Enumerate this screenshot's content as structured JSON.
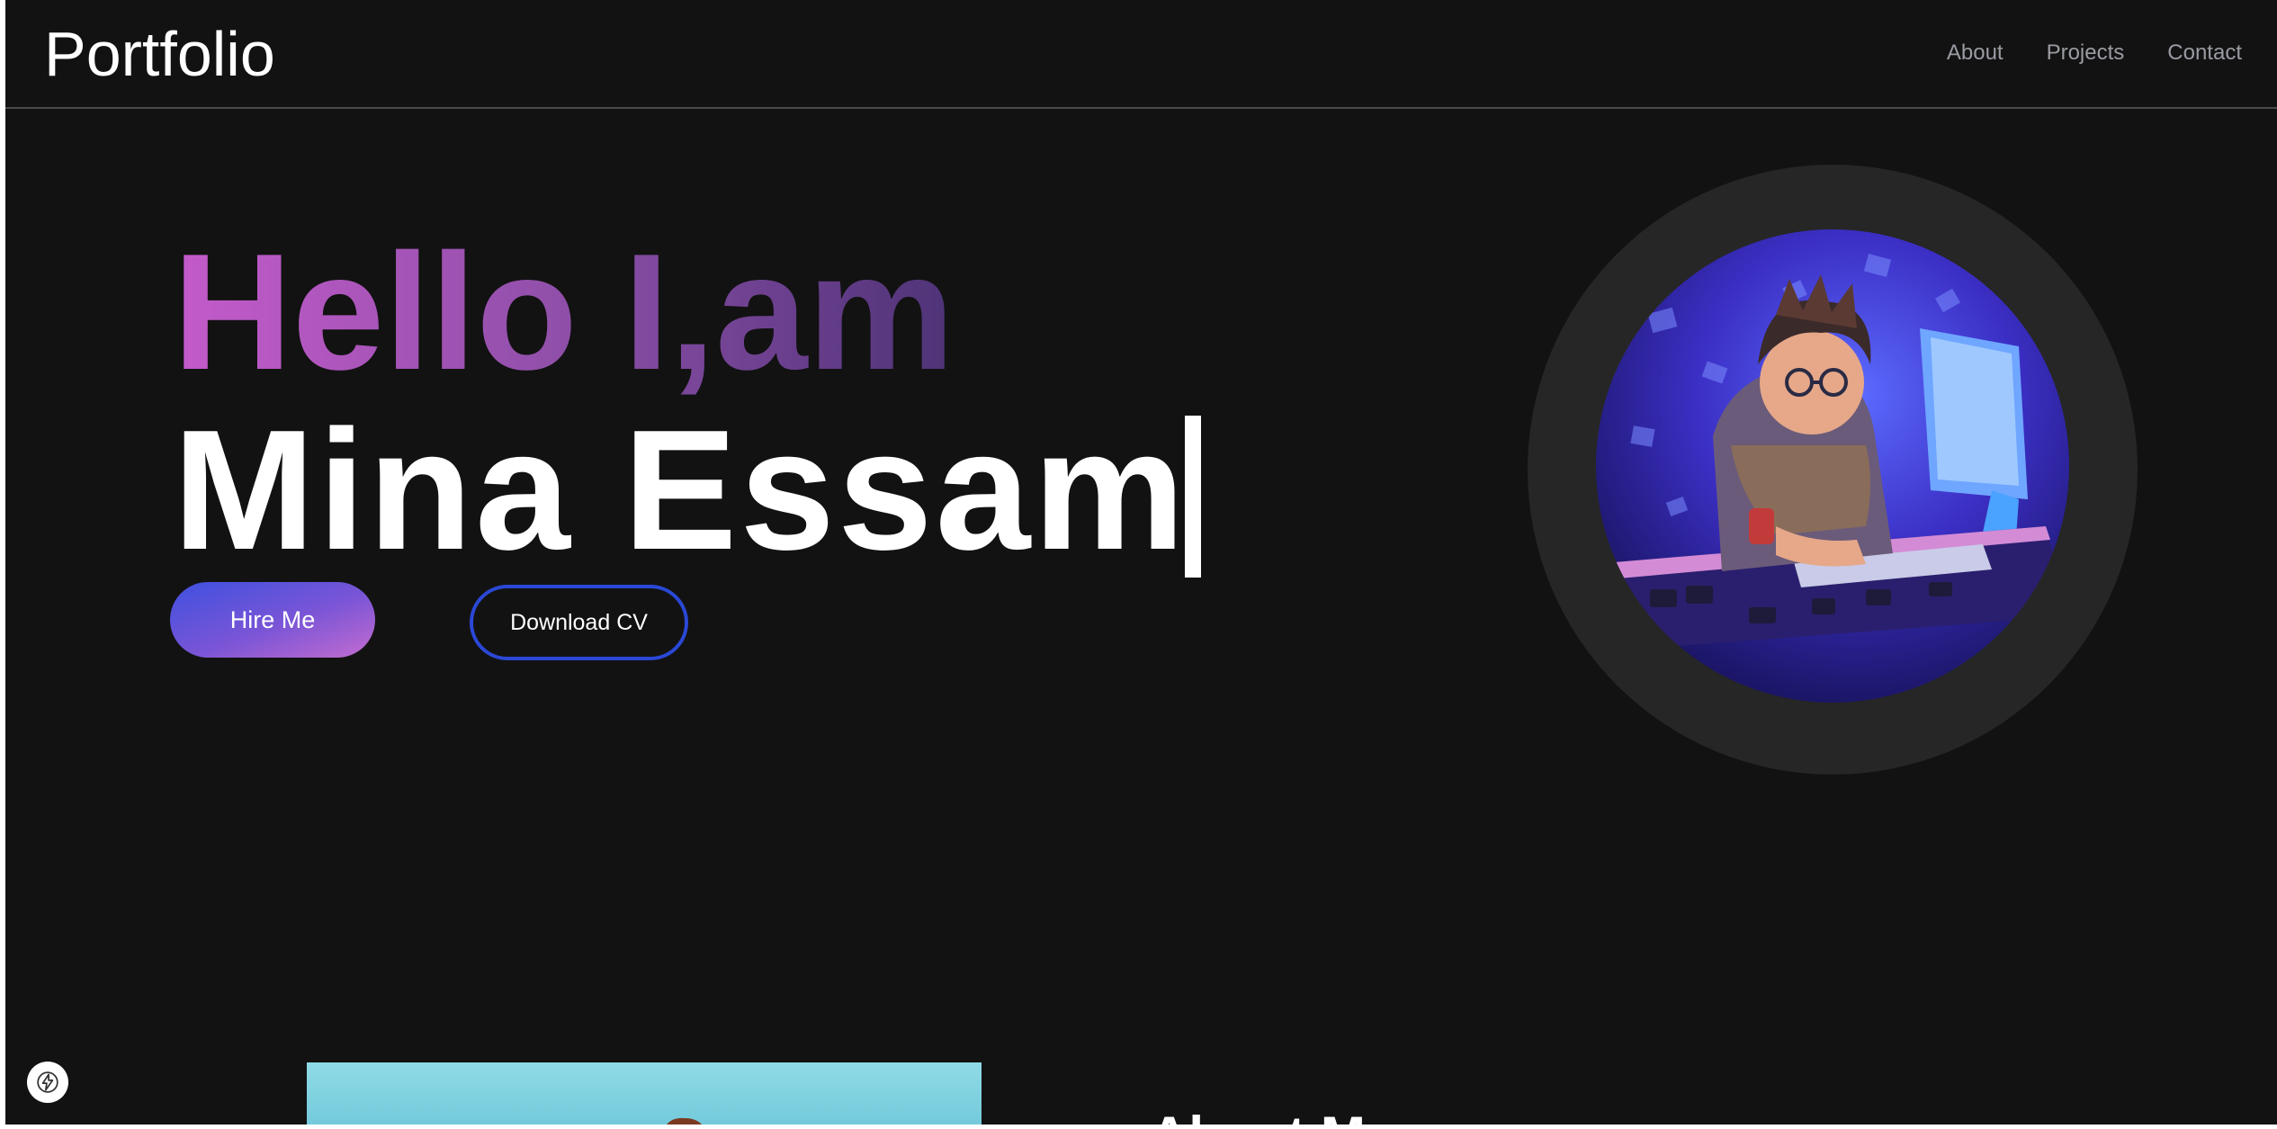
{
  "navbar": {
    "brand": "Portfolio",
    "links": [
      {
        "label": "About"
      },
      {
        "label": "Projects"
      },
      {
        "label": "Contact"
      }
    ]
  },
  "hero": {
    "greeting": "Hello I,am",
    "name": "Mina Essam",
    "hire_button": "Hire Me",
    "cv_button": "Download CV",
    "avatar_icon": "developer-avatar-icon"
  },
  "about": {
    "title": "About Me"
  },
  "colors": {
    "background": "#121212",
    "accent_blue": "#2b48d6",
    "accent_purple": "#c45bcb",
    "ring": "#262626"
  }
}
